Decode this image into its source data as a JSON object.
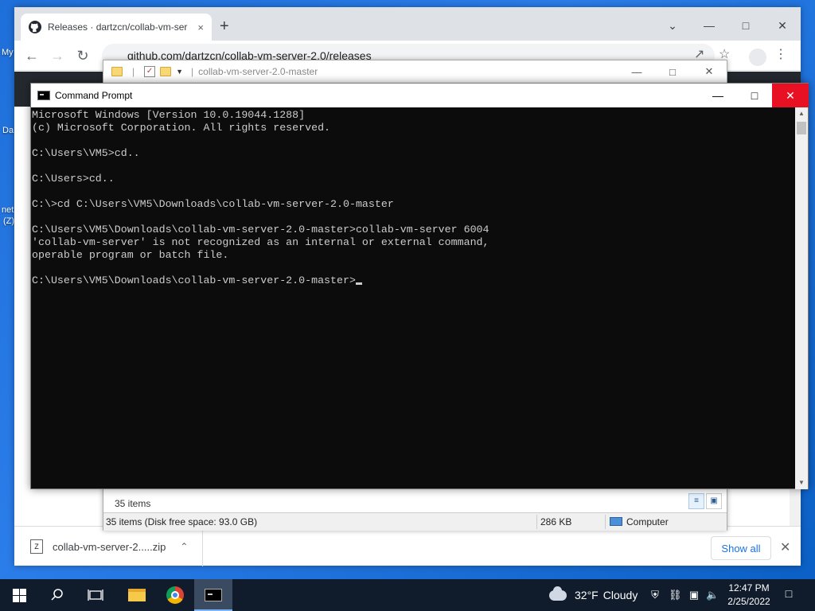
{
  "desktop": {
    "fragments": [
      "My",
      "Da",
      "net",
      "(Z)"
    ]
  },
  "chrome": {
    "tab_title": "Releases · dartzcn/collab-vm-ser",
    "tab_close": "×",
    "new_tab": "+",
    "address": "github.com/dartzcn/collab-vm-server-2.0/releases",
    "download": {
      "filename": "collab-vm-server-2.....zip",
      "show_all": "Show all"
    }
  },
  "explorer": {
    "title": "collab-vm-server-2.0-master",
    "items_count": "35 items",
    "status_items": "35 items (Disk free space: 93.0 GB)",
    "status_size": "286 KB",
    "status_location": "Computer"
  },
  "cmd": {
    "title": "Command Prompt",
    "lines": [
      "Microsoft Windows [Version 10.0.19044.1288]",
      "(c) Microsoft Corporation. All rights reserved.",
      "",
      "C:\\Users\\VM5>cd..",
      "",
      "C:\\Users>cd..",
      "",
      "C:\\>cd C:\\Users\\VM5\\Downloads\\collab-vm-server-2.0-master",
      "",
      "C:\\Users\\VM5\\Downloads\\collab-vm-server-2.0-master>collab-vm-server 6004",
      "'collab-vm-server' is not recognized as an internal or external command,",
      "operable program or batch file.",
      "",
      "C:\\Users\\VM5\\Downloads\\collab-vm-server-2.0-master>"
    ]
  },
  "taskbar": {
    "weather_temp": "32°F",
    "weather_desc": "Cloudy",
    "time": "12:47 PM",
    "date": "2/25/2022"
  },
  "colors": {
    "cmd_background": "#0c0c0c",
    "cmd_text": "#cccccc",
    "close_red": "#e81123",
    "taskbar": "#101c2c"
  }
}
